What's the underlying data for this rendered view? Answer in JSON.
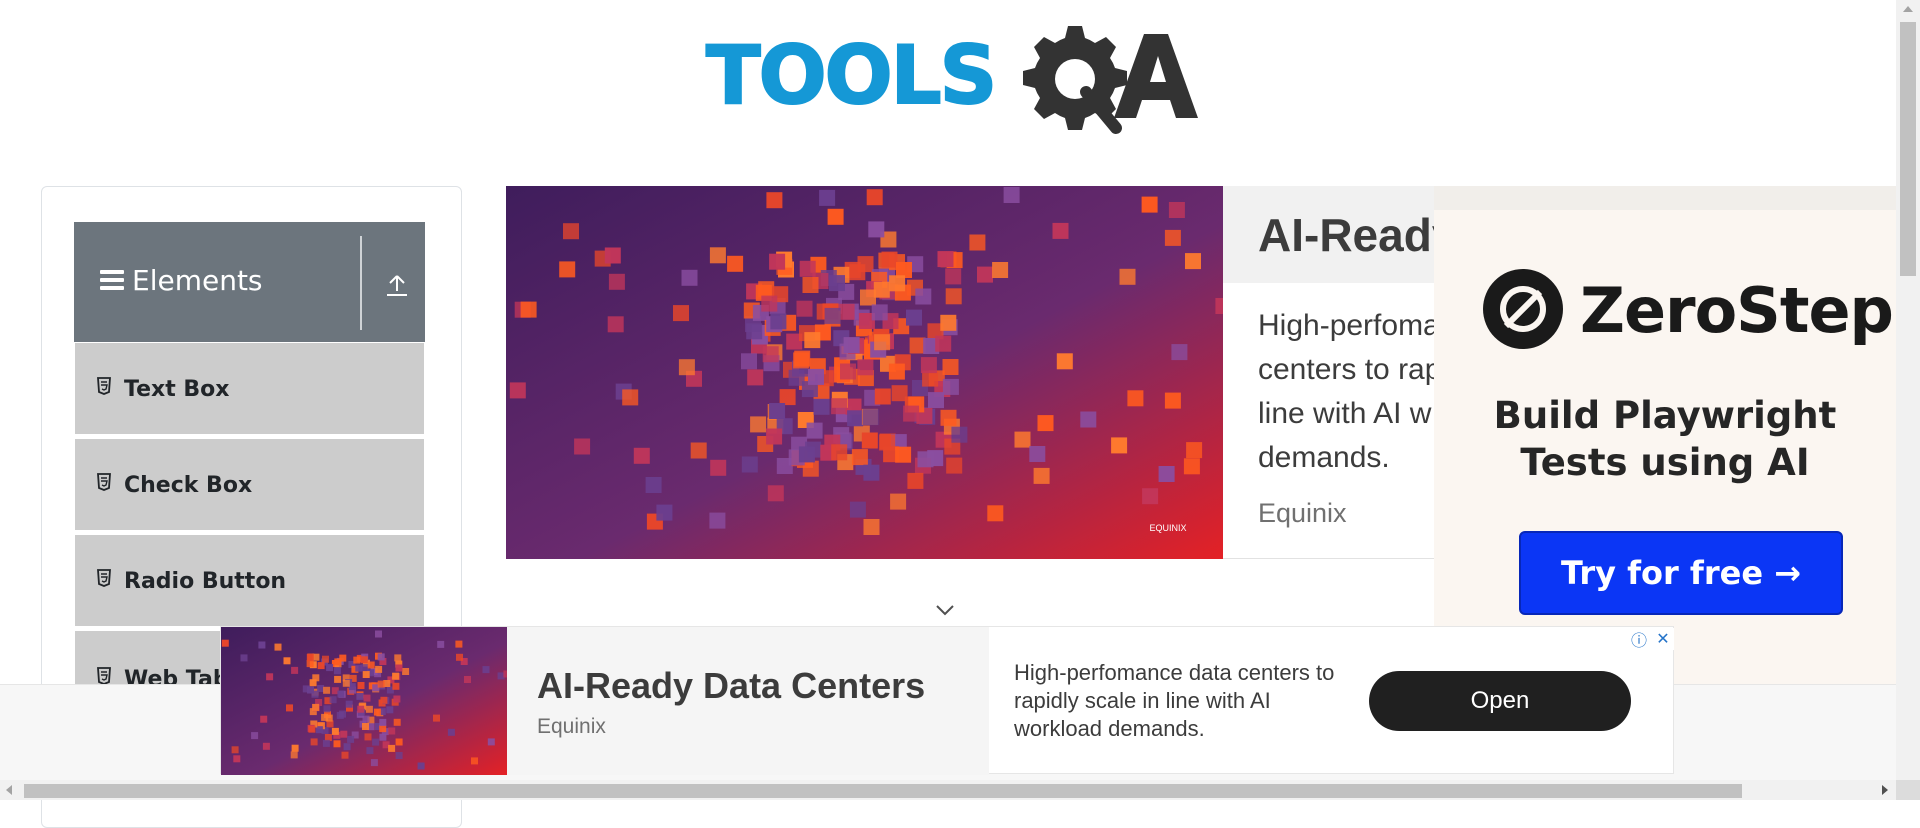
{
  "logo": {
    "text_tools": "TOOLS",
    "icon": "gear-magnifier-icon"
  },
  "sidebar": {
    "group_title": "Elements",
    "items": [
      {
        "label": "Text Box",
        "icon": "document-icon"
      },
      {
        "label": "Check Box",
        "icon": "document-icon"
      },
      {
        "label": "Radio Button",
        "icon": "document-icon"
      },
      {
        "label": "Web Tab",
        "icon": "document-icon"
      }
    ]
  },
  "ad_main": {
    "title": "AI-Ready",
    "body_lines": [
      "High-perfoma",
      "centers to rap",
      "line with AI w",
      "demands."
    ],
    "sponsor": "Equinix",
    "art_brand": "EQUINIX"
  },
  "ad_side": {
    "brand": "ZeroStep",
    "headline_line1": "Build Playwright",
    "headline_line2": "Tests using AI",
    "cta": "Try for free →"
  },
  "ad_bottom": {
    "title": "AI-Ready Data Centers",
    "sponsor": "Equinix",
    "description": "High-perfomance data centers to rapidly scale in line with AI workload demands.",
    "button": "Open"
  },
  "colors": {
    "logo_blue": "#1598d6",
    "logo_gray": "#333333",
    "group_header": "#6c757d",
    "menu_item": "#cccccc",
    "cta_blue": "#0b36f5"
  }
}
